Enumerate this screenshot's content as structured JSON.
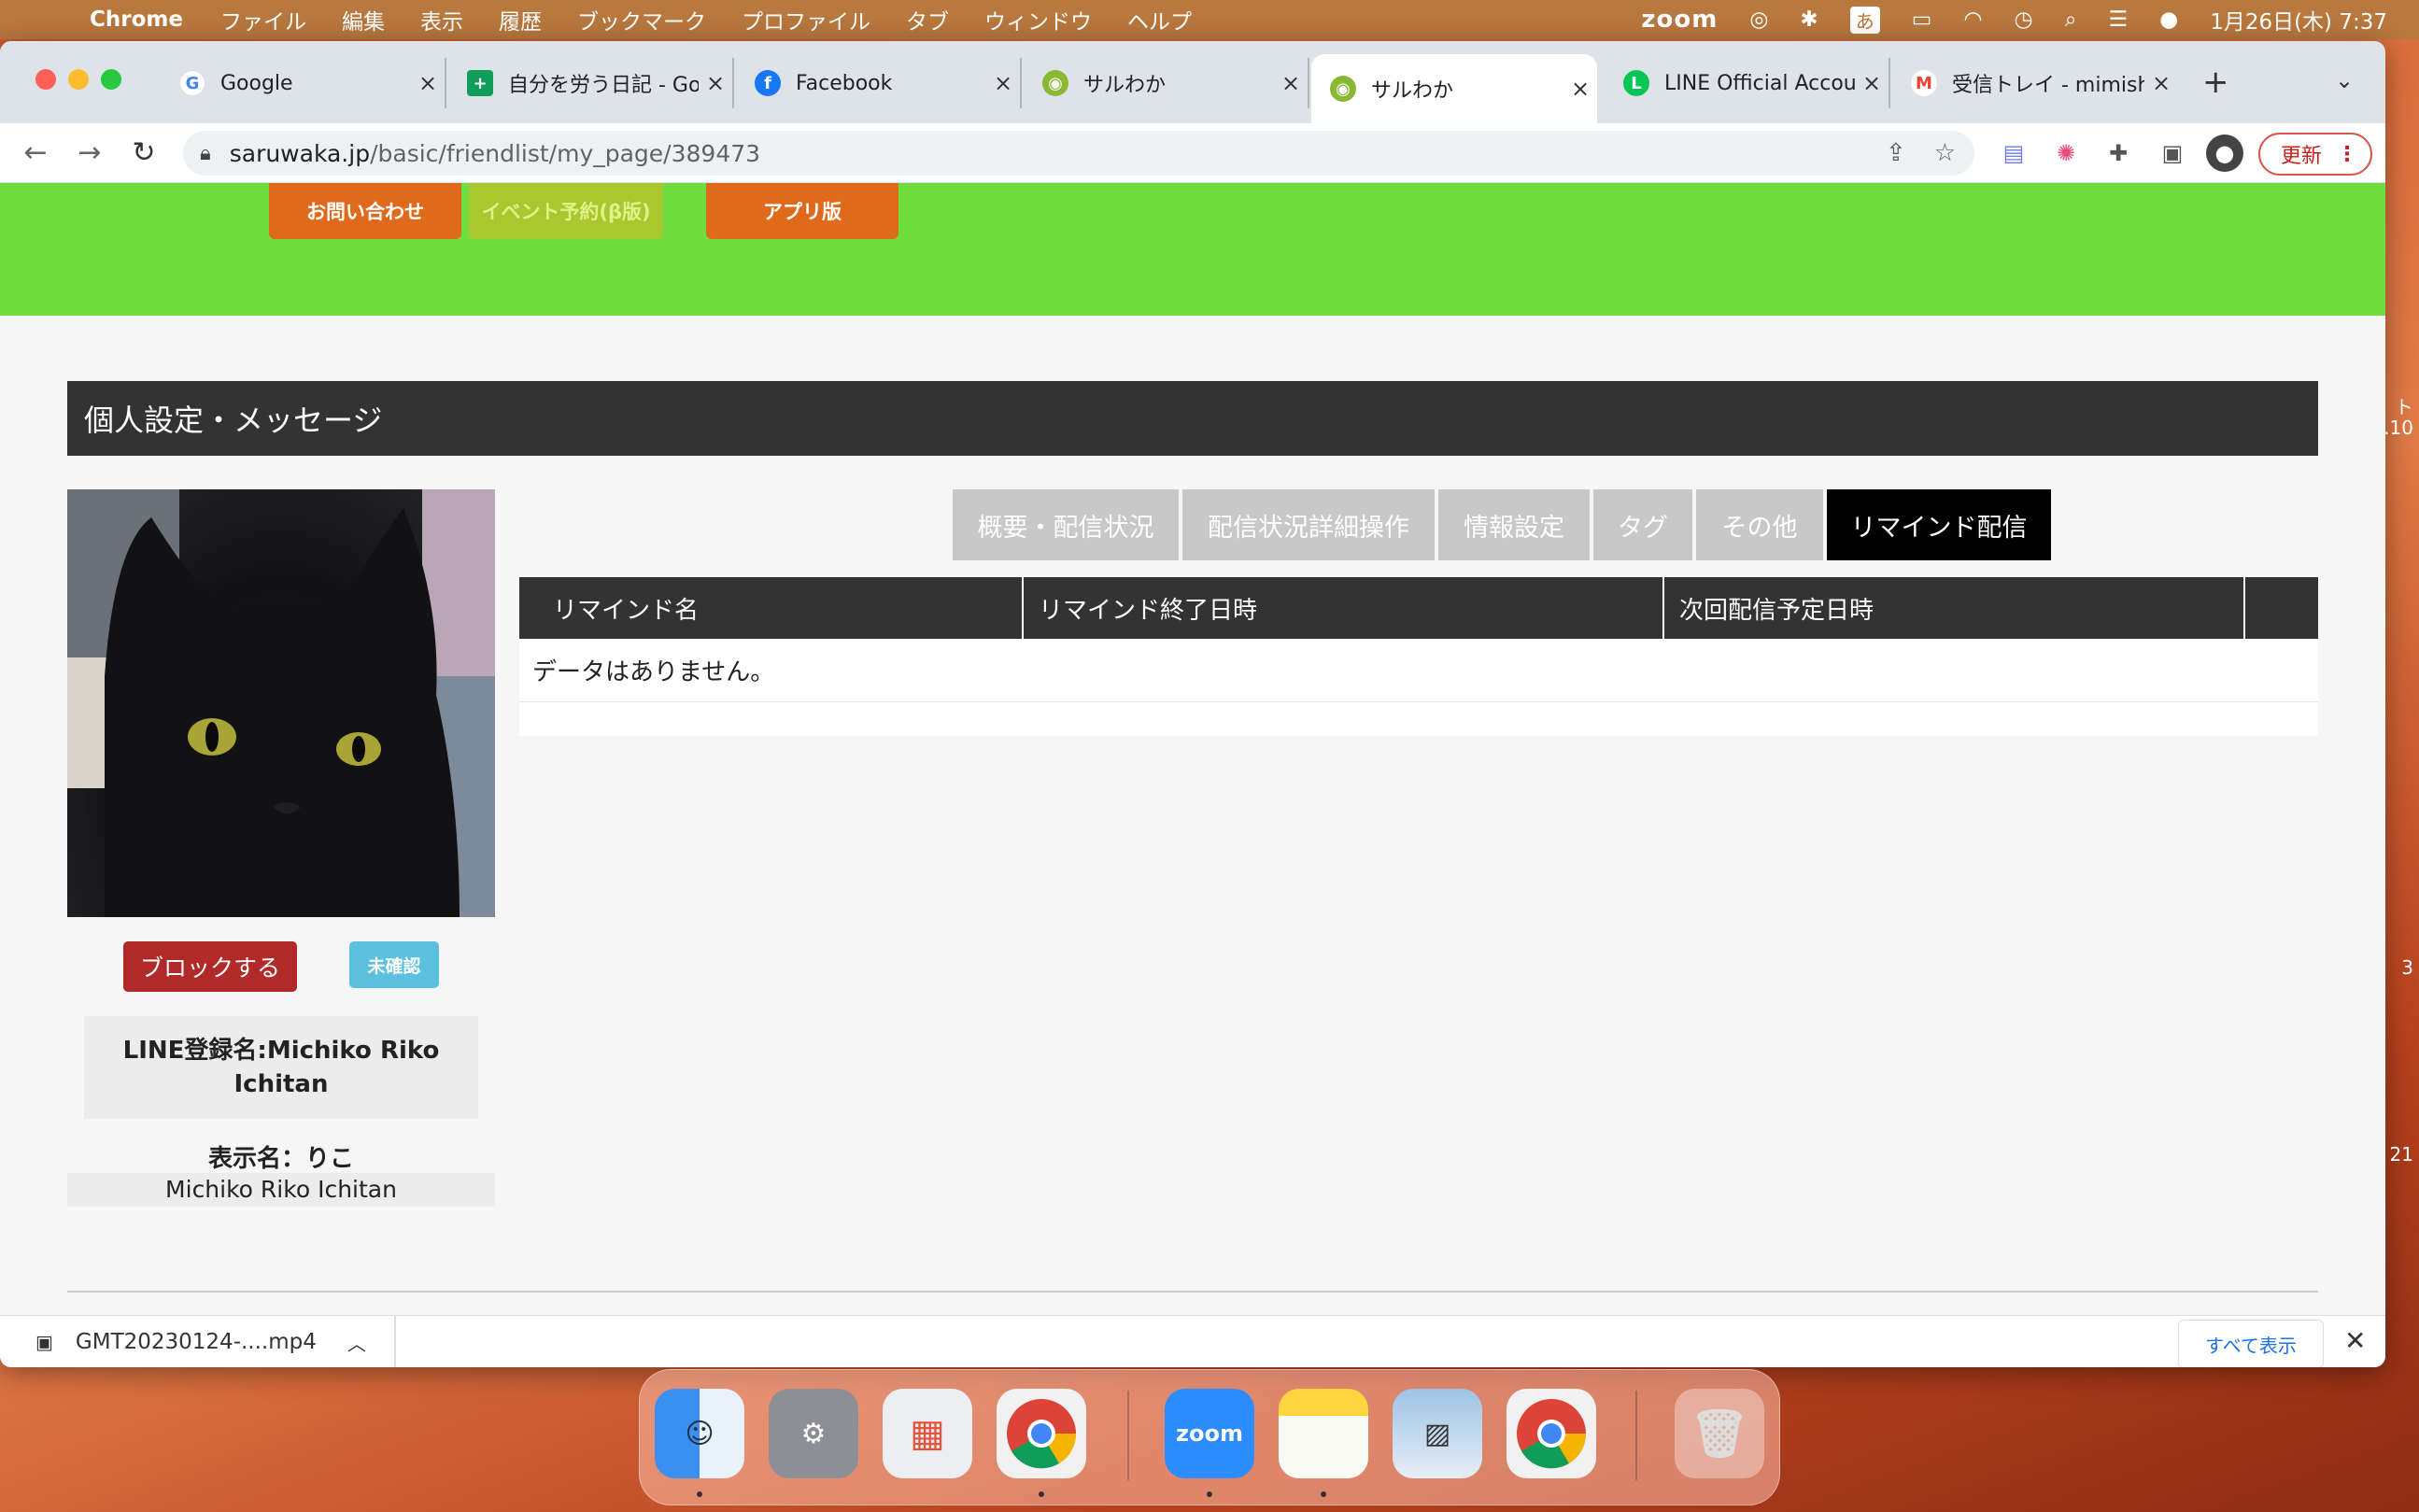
{
  "menubar": {
    "app": "Chrome",
    "items": [
      "ファイル",
      "編集",
      "表示",
      "履歴",
      "ブックマーク",
      "プロファイル",
      "タブ",
      "ウィンドウ",
      "ヘルプ"
    ],
    "zoom": "zoom",
    "ime": "あ",
    "datetime": "1月26日(木) 7:37"
  },
  "tabs": [
    {
      "title": "Google",
      "favicon": "google-icon",
      "color": "#4285f4"
    },
    {
      "title": "自分を労う日記 - Goo",
      "favicon": "sheets-icon",
      "color": "#0f9d58"
    },
    {
      "title": "Facebook",
      "favicon": "facebook-icon",
      "color": "#1877f2"
    },
    {
      "title": "サルわか",
      "favicon": "saruwaka-icon",
      "color": "#8ab832"
    },
    {
      "title": "サルわか",
      "favicon": "saruwaka-icon",
      "color": "#8ab832"
    },
    {
      "title": "LINE Official Accou",
      "favicon": "line-icon",
      "color": "#06c755"
    },
    {
      "title": "受信トレイ - mimish",
      "favicon": "gmail-icon",
      "color": "#ea4335"
    }
  ],
  "address": {
    "host": "saruwaka.jp",
    "path": "/basic/friendlist/my_page/389473"
  },
  "update_label": "更新",
  "top_buttons": {
    "contact": "お問い合わせ",
    "event": "イベント予約(β版)",
    "app": "アプリ版"
  },
  "section_title": "個人設定・メッセージ",
  "profile": {
    "block_label": "ブロックする",
    "unconfirmed_label": "未確認",
    "line_name": "LINE登録名:Michiko Riko Ichitan",
    "display_name": "表示名：りこ",
    "real_name": "Michiko Riko Ichitan"
  },
  "page_tabs": [
    {
      "label": "概要・配信状況",
      "active": false
    },
    {
      "label": "配信状況詳細操作",
      "active": false
    },
    {
      "label": "情報設定",
      "active": false
    },
    {
      "label": "タグ",
      "active": false
    },
    {
      "label": "その他",
      "active": false
    },
    {
      "label": "リマインド配信",
      "active": true
    }
  ],
  "table": {
    "headers": [
      "リマインド名",
      "リマインド終了日時",
      "次回配信予定日時",
      ""
    ],
    "empty": "データはありません。"
  },
  "download": {
    "filename": "GMT20230124-....mp4",
    "show_all": "すべて表示"
  },
  "dock": [
    "finder",
    "system-preferences",
    "launchpad",
    "chrome",
    "zoom",
    "notes",
    "preview",
    "chrome",
    "trash"
  ]
}
